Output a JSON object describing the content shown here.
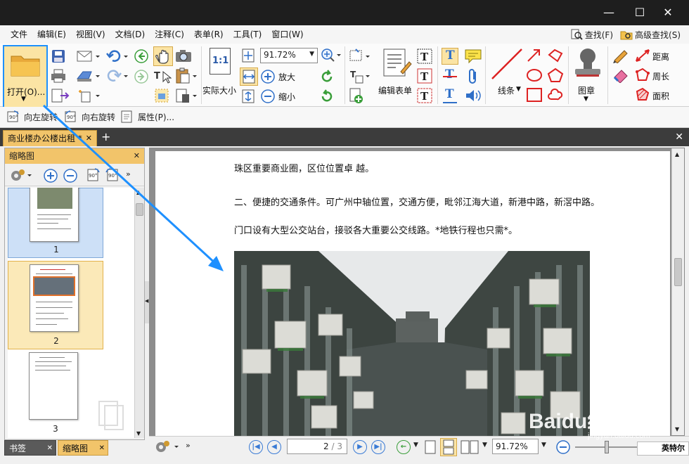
{
  "menubar": {
    "items": [
      "文件",
      "编辑(E)",
      "视图(V)",
      "文档(D)",
      "注释(C)",
      "表单(R)",
      "工具(T)",
      "窗口(W)"
    ],
    "find_label": "查找(F)",
    "advanced_find_label": "高级查找(S)"
  },
  "ribbon": {
    "open_label": "打开(O)...",
    "actual_size_label": "实际大小",
    "actual_size_icon_text": "1:1",
    "zoom_value": "91.72%",
    "zoom_in_label": "放大",
    "zoom_out_label": "缩小",
    "edit_form_label": "编辑表单",
    "lines_label": "线条",
    "stamp_label": "图章",
    "distance_label": "距离",
    "perimeter_label": "周长",
    "area_label": "面积",
    "highlight_color": "#1e90ff"
  },
  "quickbar": {
    "rotate_left_label": "向左旋转",
    "rotate_right_label": "向右旋转",
    "properties_label": "属性(P)..."
  },
  "doc_tab": {
    "title": "商业楼办公楼出租 *"
  },
  "side_panel": {
    "title": "缩略图",
    "pages": [
      "1",
      "2",
      "3"
    ],
    "bottom_tabs": [
      "书签",
      "缩略图"
    ]
  },
  "document": {
    "lines": [
      "珠区重要商业圈，区位位置卓 越。",
      "二、便捷的交通条件。可广州中轴位置，交通方便，毗邻江海大道，新港中路，新滘中路。",
      "门口设有大型公交站台，接驳各大重要公交线路。*地铁行程也只需*。"
    ]
  },
  "statusbar": {
    "page_value": "2",
    "page_total": "/ 3",
    "zoom_value": "91.72%"
  },
  "ime": {
    "label": "英特尔"
  },
  "watermark": {
    "text": "Baidu经验",
    "sub": "jingyan.baidu.com"
  }
}
